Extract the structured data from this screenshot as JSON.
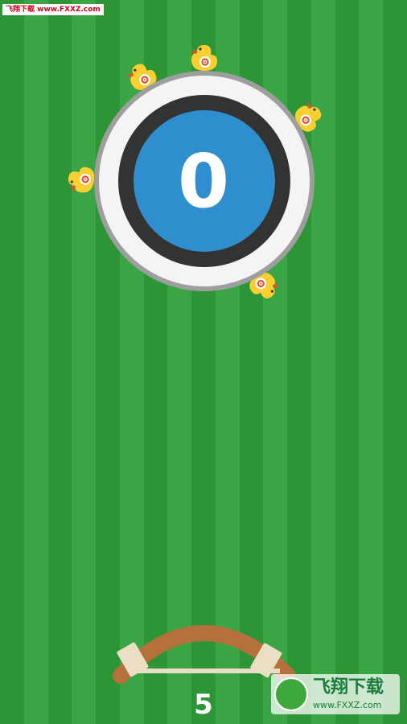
{
  "watermark_top": "飞翔下载 www.FXXZ.com",
  "score": "0",
  "arrows_remaining": "5",
  "watermark_bottom": {
    "brand": "飞翔下载",
    "url": "www.FXXZ.com"
  },
  "colors": {
    "grass_dark": "#2e9536",
    "grass_light": "#3aa545",
    "target_outer_ring": "#9e9e9e",
    "target_white": "#f4f4f4",
    "target_black": "#333333",
    "target_center": "#2f8fce",
    "duck_body": "#fbcf2f",
    "duck_beak": "#e94f27",
    "bow_wood": "#b6703b",
    "bow_grip": "#eadfc4"
  },
  "ducks": [
    {
      "name": "duck-top",
      "icon": "duck-target-icon"
    },
    {
      "name": "duck-upper-left",
      "icon": "duck-target-icon"
    },
    {
      "name": "duck-upper-right",
      "icon": "duck-target-icon"
    },
    {
      "name": "duck-left",
      "icon": "duck-target-icon"
    },
    {
      "name": "duck-lower-right",
      "icon": "duck-target-icon"
    }
  ]
}
